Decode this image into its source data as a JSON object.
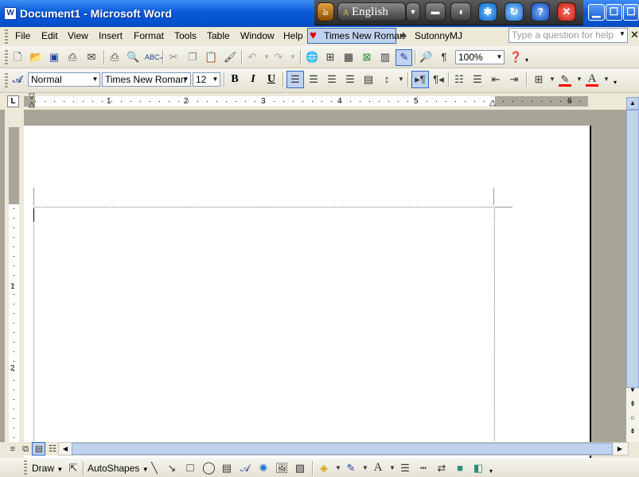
{
  "window": {
    "title": "Document1 - Microsoft Word",
    "app_icon": "W"
  },
  "langbar": {
    "language": "English",
    "language_icon": "A",
    "help": "?",
    "close": "✕"
  },
  "menu": {
    "items": [
      "File",
      "Edit",
      "View",
      "Insert",
      "Format",
      "Tools",
      "Table",
      "Window",
      "Help"
    ],
    "font_button": "Times New Roman",
    "font_button2": "SutonnyMJ",
    "help_placeholder": "Type a question for help"
  },
  "standard": {
    "zoom": "100%"
  },
  "formatting": {
    "style": "Normal",
    "font": "Times New Roman",
    "size": "12",
    "bold": "B",
    "italic": "I",
    "underline": "U"
  },
  "ruler": {
    "marks": [
      "1",
      "2",
      "3",
      "4",
      "5",
      "6"
    ]
  },
  "vruler": {
    "marks": [
      "1",
      "2"
    ]
  },
  "drawing": {
    "draw": "Draw",
    "autoshapes": "AutoShapes"
  },
  "colors": {
    "titlebar": "#0a5ad8",
    "highlight": "#c1d2ee",
    "font_color": "#ff0000"
  }
}
